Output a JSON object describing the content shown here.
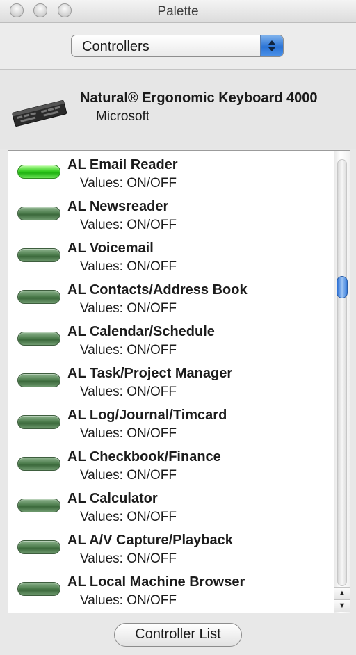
{
  "window": {
    "title": "Palette"
  },
  "selector": {
    "selected": "Controllers"
  },
  "device": {
    "name": "Natural® Ergonomic Keyboard 4000",
    "manufacturer": "Microsoft",
    "icon": "keyboard-icon"
  },
  "controls": [
    {
      "name": "AL Email Reader",
      "values": "Values: ON/OFF",
      "state": "on"
    },
    {
      "name": "AL Newsreader",
      "values": "Values: ON/OFF",
      "state": "off"
    },
    {
      "name": "AL Voicemail",
      "values": "Values: ON/OFF",
      "state": "off"
    },
    {
      "name": "AL Contacts/Address Book",
      "values": "Values: ON/OFF",
      "state": "off"
    },
    {
      "name": "AL Calendar/Schedule",
      "values": "Values: ON/OFF",
      "state": "off"
    },
    {
      "name": "AL Task/Project Manager",
      "values": "Values: ON/OFF",
      "state": "off"
    },
    {
      "name": "AL Log/Journal/Timcard",
      "values": "Values: ON/OFF",
      "state": "off"
    },
    {
      "name": "AL Checkbook/Finance",
      "values": "Values: ON/OFF",
      "state": "off"
    },
    {
      "name": "AL Calculator",
      "values": "Values: ON/OFF",
      "state": "off"
    },
    {
      "name": "AL A/V Capture/Playback",
      "values": "Values: ON/OFF",
      "state": "off"
    },
    {
      "name": "AL Local Machine Browser",
      "values": "Values: ON/OFF",
      "state": "off"
    }
  ],
  "footer": {
    "button_label": "Controller List"
  },
  "colors": {
    "led_on": "#37cf22",
    "led_off": "#4f7f4f",
    "accent": "#2a73d6"
  }
}
